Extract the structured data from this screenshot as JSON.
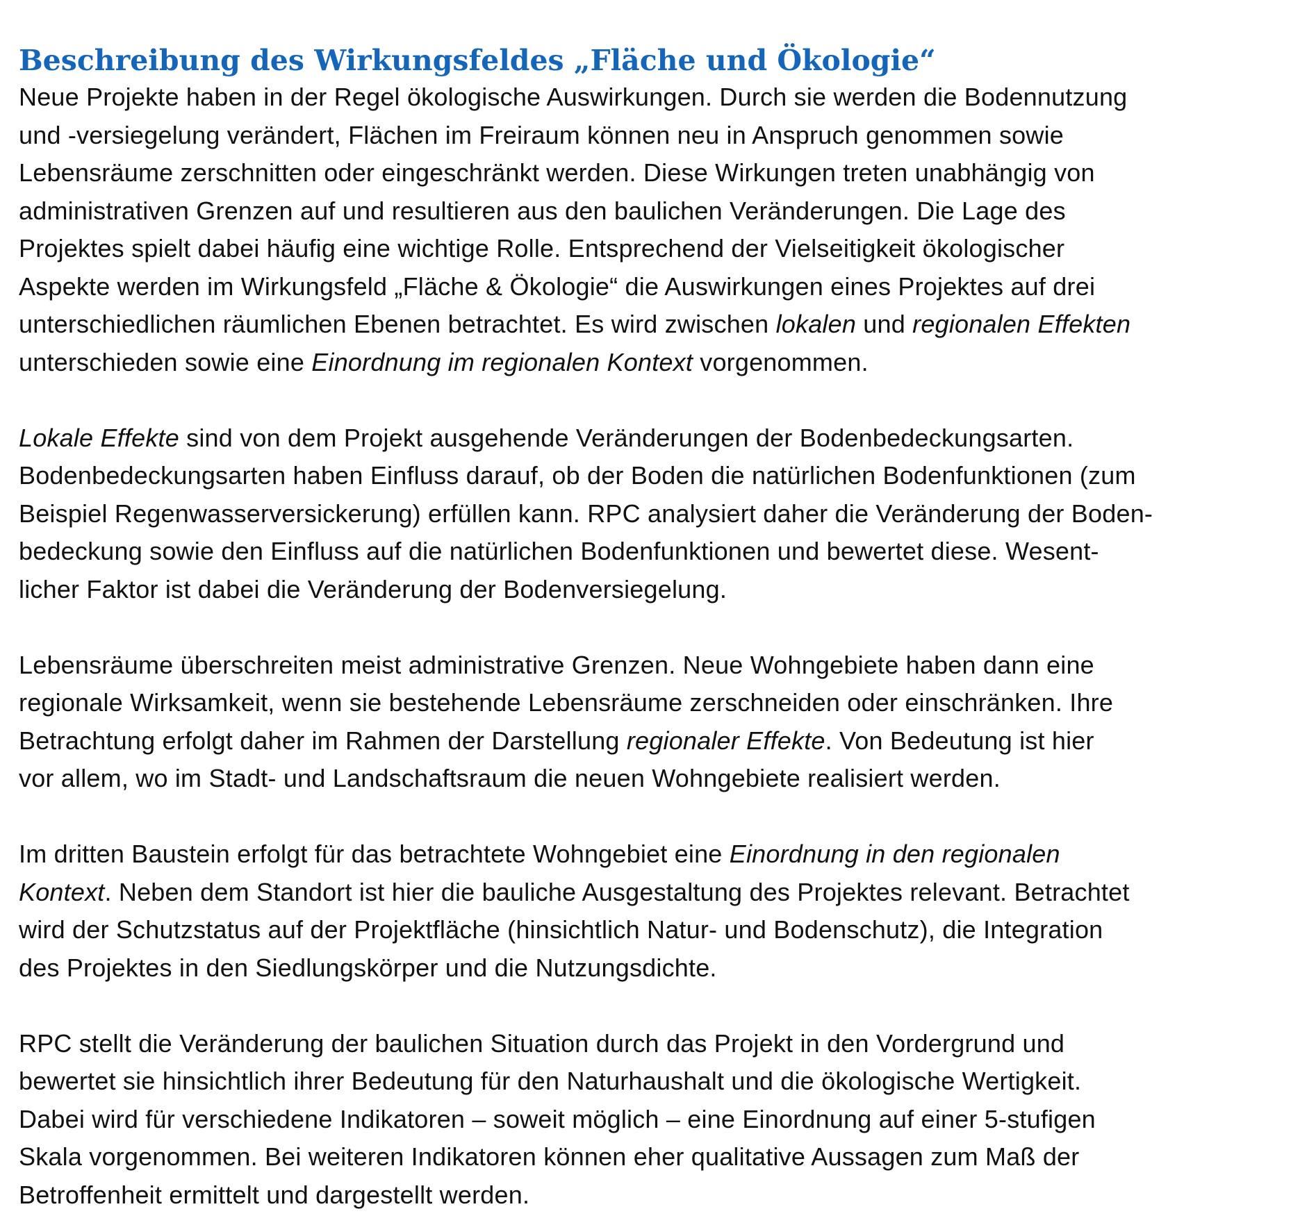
{
  "heading": "Beschreibung des Wirkungsfeldes „Fläche und Ökologie“",
  "paragraphs": [
    {
      "lines": [
        [
          {
            "t": "Neue Projekte haben in der Regel ökologische Auswirkungen. Durch sie werden die Bodennutzung"
          }
        ],
        [
          {
            "t": "und -versiegelung verändert, Flächen im Freiraum können neu in Anspruch genommen sowie"
          }
        ],
        [
          {
            "t": "Lebensräume zerschnitten oder eingeschränkt werden. Diese Wirkungen treten unabhängig von"
          }
        ],
        [
          {
            "t": "administrativen Grenzen auf und resultieren aus den baulichen Veränderungen. Die Lage des"
          }
        ],
        [
          {
            "t": "Projektes spielt dabei häufig eine wichtige Rolle. Entsprechend der Vielseitigkeit ökologischer"
          }
        ],
        [
          {
            "t": "Aspekte werden im Wirkungsfeld „Fläche & Ökologie“ die Auswirkungen eines Projektes auf drei"
          }
        ],
        [
          {
            "t": "unterschiedlichen räumlichen Ebenen betrachtet. Es wird zwischen "
          },
          {
            "t": "lokalen",
            "i": true
          },
          {
            "t": " und "
          },
          {
            "t": "regionalen Effekten",
            "i": true
          }
        ],
        [
          {
            "t": "unterschieden sowie eine "
          },
          {
            "t": "Einordnung im regionalen Kontext",
            "i": true
          },
          {
            "t": " vorgenommen."
          }
        ]
      ]
    },
    {
      "lines": [
        [
          {
            "t": "Lokale Effekte",
            "i": true
          },
          {
            "t": " sind von dem Projekt ausgehende Veränderungen der Bodenbedeckungsarten."
          }
        ],
        [
          {
            "t": "Bodenbedeckungsarten haben Einfluss darauf, ob der Boden die natürlichen Bodenfunktionen (zum"
          }
        ],
        [
          {
            "t": "Beispiel Regenwasserversickerung) erfüllen kann. RPC analysiert daher die Veränderung der Boden-"
          }
        ],
        [
          {
            "t": "bedeckung sowie den Einfluss auf die natürlichen Bodenfunktionen und bewertet diese. Wesent-"
          }
        ],
        [
          {
            "t": "licher Faktor ist dabei die Veränderung der Bodenversiegelung."
          }
        ]
      ]
    },
    {
      "lines": [
        [
          {
            "t": "Lebensräume überschreiten meist administrative Grenzen. Neue Wohngebiete haben dann eine"
          }
        ],
        [
          {
            "t": "regionale Wirksamkeit, wenn sie bestehende Lebensräume zerschneiden oder einschränken. Ihre"
          }
        ],
        [
          {
            "t": "Betrachtung erfolgt daher im Rahmen der Darstellung "
          },
          {
            "t": "regionaler Effekte",
            "i": true
          },
          {
            "t": ". Von Bedeutung ist hier"
          }
        ],
        [
          {
            "t": "vor allem, wo im Stadt- und Landschaftsraum die neuen Wohngebiete realisiert werden."
          }
        ]
      ]
    },
    {
      "lines": [
        [
          {
            "t": "Im dritten Baustein erfolgt für das betrachtete Wohngebiet eine "
          },
          {
            "t": "Einordnung in den regionalen",
            "i": true
          }
        ],
        [
          {
            "t": "Kontext",
            "i": true
          },
          {
            "t": ". Neben dem Standort ist hier die bauliche Ausgestaltung des Projektes relevant. Betrachtet"
          }
        ],
        [
          {
            "t": "wird der Schutzstatus auf der Projektfläche (hinsichtlich Natur- und Bodenschutz), die Integration"
          }
        ],
        [
          {
            "t": "des Projektes in den Siedlungskörper und die Nutzungsdichte."
          }
        ]
      ]
    },
    {
      "lines": [
        [
          {
            "t": "RPC stellt die Veränderung der baulichen Situation durch das Projekt in den Vordergrund und"
          }
        ],
        [
          {
            "t": "bewertet sie hinsichtlich ihrer Bedeutung für den Naturhaushalt und die ökologische Wertigkeit."
          }
        ],
        [
          {
            "t": "Dabei wird für verschiedene Indikatoren – soweit möglich – eine Einordnung auf einer 5-stufigen"
          }
        ],
        [
          {
            "t": "Skala vorgenommen. Bei weiteren Indikatoren können eher qualitative Aussagen zum Maß der"
          }
        ],
        [
          {
            "t": "Betroffenheit ermittelt und dargestellt werden."
          }
        ]
      ]
    }
  ],
  "colors": {
    "heading": "#1565b8",
    "text": "#111111",
    "background": "#ffffff"
  }
}
